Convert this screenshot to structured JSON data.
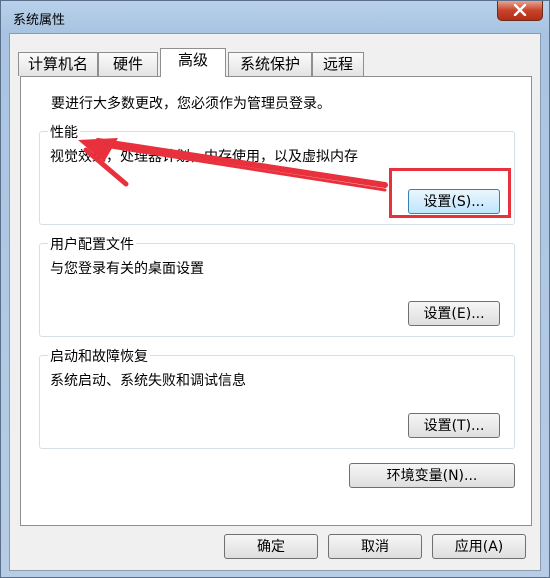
{
  "window": {
    "title": "系统属性"
  },
  "tabs": [
    {
      "label": "计算机名"
    },
    {
      "label": "硬件"
    },
    {
      "label": "高级",
      "active": true
    },
    {
      "label": "系统保护"
    },
    {
      "label": "远程"
    }
  ],
  "notice": "要进行大多数更改，您必须作为管理员登录。",
  "groups": {
    "performance": {
      "label": "性能",
      "description": "视觉效果，处理器计划，内存使用，以及虚拟内存",
      "button": "设置(S)..."
    },
    "user_profiles": {
      "label": "用户配置文件",
      "description": "与您登录有关的桌面设置",
      "button": "设置(E)..."
    },
    "startup_recovery": {
      "label": "启动和故障恢复",
      "description": "系统启动、系统失败和调试信息",
      "button": "设置(T)..."
    }
  },
  "env_button": "环境变量(N)...",
  "footer": {
    "ok": "确定",
    "cancel": "取消",
    "apply": "应用(A)"
  },
  "colors": {
    "annotation": "#e8313c",
    "focus_border": "#3c7fb1"
  }
}
